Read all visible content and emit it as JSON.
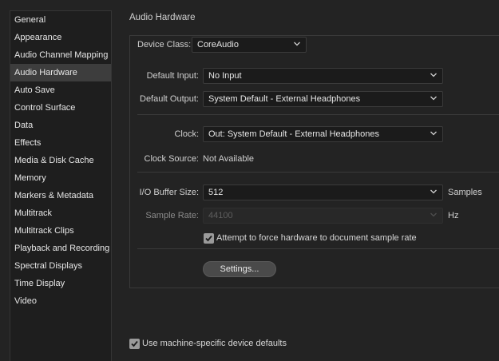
{
  "theme": {
    "bg": "#232323",
    "text": "#d6d6d6",
    "selected_bg": "#3d3d3d",
    "check_color": "#1a1a1a"
  },
  "sidebar": {
    "items": [
      {
        "label": "General"
      },
      {
        "label": "Appearance"
      },
      {
        "label": "Audio Channel Mapping"
      },
      {
        "label": "Audio Hardware",
        "selected": true
      },
      {
        "label": "Auto Save"
      },
      {
        "label": "Control Surface"
      },
      {
        "label": "Data"
      },
      {
        "label": "Effects"
      },
      {
        "label": "Media & Disk Cache"
      },
      {
        "label": "Memory"
      },
      {
        "label": "Markers & Metadata"
      },
      {
        "label": "Multitrack"
      },
      {
        "label": "Multitrack Clips"
      },
      {
        "label": "Playback and Recording"
      },
      {
        "label": "Spectral Displays"
      },
      {
        "label": "Time Display"
      },
      {
        "label": "Video"
      }
    ]
  },
  "page": {
    "title": "Audio Hardware"
  },
  "device_class": {
    "label": "Device Class:",
    "value": "CoreAudio"
  },
  "default_input": {
    "label": "Default Input:",
    "value": "No Input"
  },
  "default_output": {
    "label": "Default Output:",
    "value": "System Default - External Headphones"
  },
  "clock": {
    "label": "Clock:",
    "value": "Out: System Default - External Headphones"
  },
  "clock_source": {
    "label": "Clock Source:",
    "value": "Not Available"
  },
  "buffer_size": {
    "label": "I/O Buffer Size:",
    "value": "512",
    "unit": "Samples"
  },
  "sample_rate": {
    "label": "Sample Rate:",
    "value": "44100",
    "unit": "Hz",
    "disabled": true
  },
  "force_rate": {
    "label": "Attempt to force hardware to document sample rate",
    "checked": true
  },
  "settings_button": {
    "label": "Settings..."
  },
  "machine_defaults": {
    "label": "Use machine-specific device defaults",
    "checked": true
  }
}
